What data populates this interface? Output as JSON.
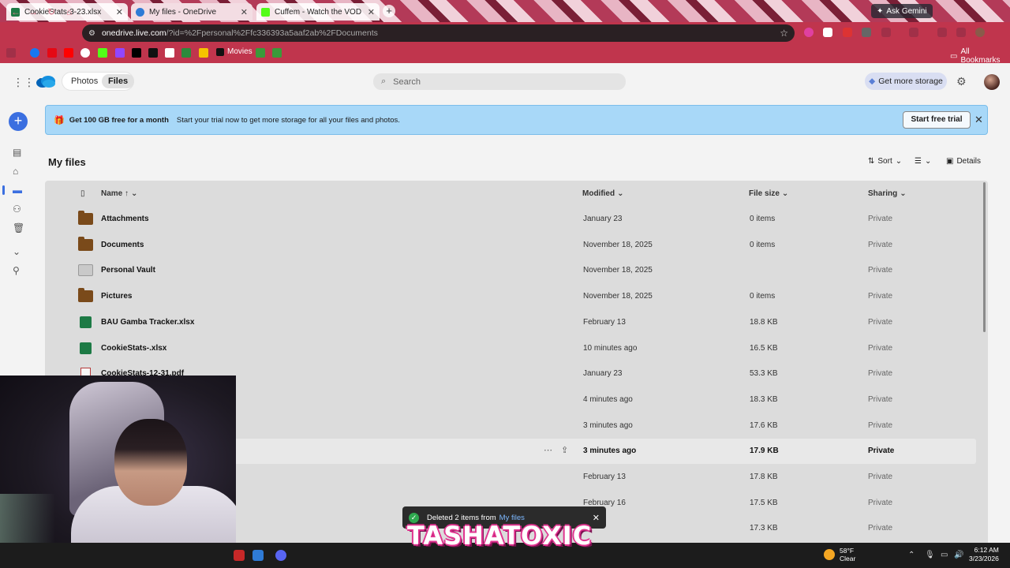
{
  "browser": {
    "tabs": [
      {
        "title": "CookieStats-3-23.xlsx",
        "favicon_color": "#1d7a45"
      },
      {
        "title": "My files - OneDrive",
        "favicon_color": "#2f7bd6"
      },
      {
        "title": "Cuffem - Watch the VOD on Kick",
        "favicon_color": "#53fc18"
      }
    ],
    "ask_gemini": "Ask Gemini",
    "url_host": "onedrive.live.com",
    "url_path": "/?id=%2Fpersonal%2Ffc336393a5aaf2ab%2FDocuments",
    "bookmark_movies": "Movies",
    "all_bookmarks": "All Bookmarks"
  },
  "app": {
    "nav_photos": "Photos",
    "nav_files": "Files",
    "search_placeholder": "Search",
    "get_storage": "Get more storage"
  },
  "banner": {
    "headline": "Get 100 GB free for a month",
    "body": "Start your trial now to get more storage for all your files and photos.",
    "cta": "Start free trial"
  },
  "page": {
    "title": "My files",
    "sort_label": "Sort",
    "details_label": "Details"
  },
  "table": {
    "headers": {
      "name": "Name ↑",
      "modified": "Modified",
      "size": "File size",
      "sharing": "Sharing"
    },
    "rows": [
      {
        "name": "Attachments",
        "type": "folder",
        "modified": "January 23",
        "size": "0 items",
        "sharing": "Private"
      },
      {
        "name": "Documents",
        "type": "folder",
        "modified": "November 18, 2025",
        "size": "0 items",
        "sharing": "Private"
      },
      {
        "name": "Personal Vault",
        "type": "vault",
        "modified": "November 18, 2025",
        "size": "",
        "sharing": "Private"
      },
      {
        "name": "Pictures",
        "type": "folder",
        "modified": "November 18, 2025",
        "size": "0 items",
        "sharing": "Private"
      },
      {
        "name": "BAU Gamba Tracker.xlsx",
        "type": "xlsx",
        "modified": "February 13",
        "size": "18.8 KB",
        "sharing": "Private"
      },
      {
        "name": "CookieStats-.xlsx",
        "type": "xlsx",
        "modified": "10 minutes ago",
        "size": "16.5 KB",
        "sharing": "Private"
      },
      {
        "name": "CookieStats-12-31.pdf",
        "type": "pdf",
        "modified": "January 23",
        "size": "53.3 KB",
        "sharing": "Private"
      },
      {
        "name": "",
        "type": "",
        "modified": "4 minutes ago",
        "size": "18.3 KB",
        "sharing": "Private"
      },
      {
        "name": "",
        "type": "",
        "modified": "3 minutes ago",
        "size": "17.6 KB",
        "sharing": "Private"
      },
      {
        "name": "",
        "type": "",
        "modified": "3 minutes ago",
        "size": "17.9 KB",
        "sharing": "Private",
        "highlighted": true
      },
      {
        "name": "",
        "type": "",
        "modified": "February 13",
        "size": "17.8 KB",
        "sharing": "Private"
      },
      {
        "name": "",
        "type": "",
        "modified": "February 16",
        "size": "17.5 KB",
        "sharing": "Private"
      },
      {
        "name": "",
        "type": "",
        "modified": "",
        "size": "17.3 KB",
        "sharing": "Private"
      }
    ]
  },
  "toast": {
    "message": "Deleted 2 items from",
    "link": "My files"
  },
  "overlay": {
    "streamer_name": "TASHATOXIC"
  },
  "taskbar": {
    "temperature": "58°F",
    "condition": "Clear",
    "time": "6:12 AM",
    "date": "3/23/2026"
  }
}
